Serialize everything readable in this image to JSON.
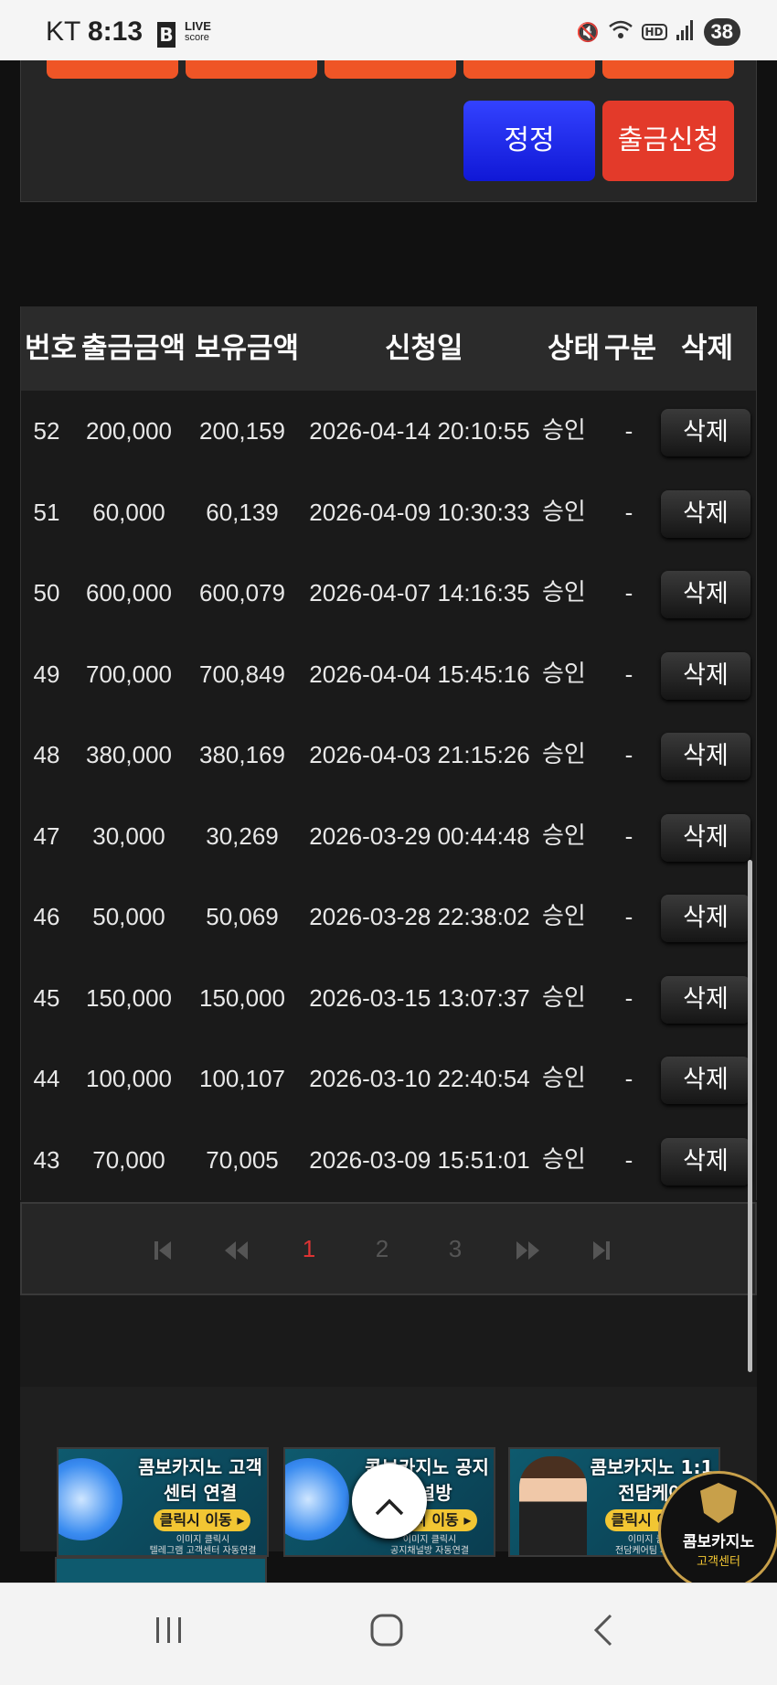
{
  "status_bar": {
    "carrier": "KT",
    "time": "8:13",
    "app_b": "B",
    "app_live": "LIVE",
    "app_score": "score",
    "hd": "HD",
    "battery": "38"
  },
  "buttons": {
    "correct": "정정",
    "withdraw_request": "출금신청"
  },
  "table": {
    "headers": {
      "no": "번호",
      "amount": "출금금액",
      "balance": "보유금액",
      "date": "신청일",
      "status": "상태",
      "type": "구분",
      "delete": "삭제"
    },
    "rows": [
      {
        "no": "52",
        "amount": "200,000",
        "balance": "200,159",
        "date": "2026-04-14 20:10:55",
        "status": "승인",
        "type": "-",
        "delete": "삭제"
      },
      {
        "no": "51",
        "amount": "60,000",
        "balance": "60,139",
        "date": "2026-04-09 10:30:33",
        "status": "승인",
        "type": "-",
        "delete": "삭제"
      },
      {
        "no": "50",
        "amount": "600,000",
        "balance": "600,079",
        "date": "2026-04-07 14:16:35",
        "status": "승인",
        "type": "-",
        "delete": "삭제"
      },
      {
        "no": "49",
        "amount": "700,000",
        "balance": "700,849",
        "date": "2026-04-04 15:45:16",
        "status": "승인",
        "type": "-",
        "delete": "삭제"
      },
      {
        "no": "48",
        "amount": "380,000",
        "balance": "380,169",
        "date": "2026-04-03 21:15:26",
        "status": "승인",
        "type": "-",
        "delete": "삭제"
      },
      {
        "no": "47",
        "amount": "30,000",
        "balance": "30,269",
        "date": "2026-03-29 00:44:48",
        "status": "승인",
        "type": "-",
        "delete": "삭제"
      },
      {
        "no": "46",
        "amount": "50,000",
        "balance": "50,069",
        "date": "2026-03-28 22:38:02",
        "status": "승인",
        "type": "-",
        "delete": "삭제"
      },
      {
        "no": "45",
        "amount": "150,000",
        "balance": "150,000",
        "date": "2026-03-15 13:07:37",
        "status": "승인",
        "type": "-",
        "delete": "삭제"
      },
      {
        "no": "44",
        "amount": "100,000",
        "balance": "100,107",
        "date": "2026-03-10 22:40:54",
        "status": "승인",
        "type": "-",
        "delete": "삭제"
      },
      {
        "no": "43",
        "amount": "70,000",
        "balance": "70,005",
        "date": "2026-03-09 15:51:01",
        "status": "승인",
        "type": "-",
        "delete": "삭제"
      }
    ]
  },
  "pagination": {
    "first": "⏮",
    "prev": "⏪",
    "pages": [
      "1",
      "2",
      "3"
    ],
    "current": "1",
    "next": "⏩",
    "last": "⏭"
  },
  "banners": [
    {
      "title": "콤보카지노 고객센터 연결",
      "cta": "클릭시 이동 ▸",
      "sub1": "이미지 클릭시",
      "sub2": "텔레그램 고객센터 자동연결"
    },
    {
      "title": "콤보카지노 공지채널방",
      "cta": "클릭시 이동 ▸",
      "sub1": "이미지 클릭시",
      "sub2": "공지채널방 자동연결"
    },
    {
      "title": "콤보카지노 1:1 전담케어",
      "cta": "클릭시 이동 ▸",
      "sub1": "이미지 클릭시",
      "sub2": "전담케어팀 자동연결"
    }
  ],
  "cs_badge": {
    "line1": "콤보카지노",
    "line2": "고객센터"
  },
  "scroll_top_icon": "chevron-up-icon",
  "colors": {
    "withdraw": "#e33a2a",
    "correct": "#1a24f0",
    "orange": "#ef5526",
    "active_page": "#dd3333"
  }
}
